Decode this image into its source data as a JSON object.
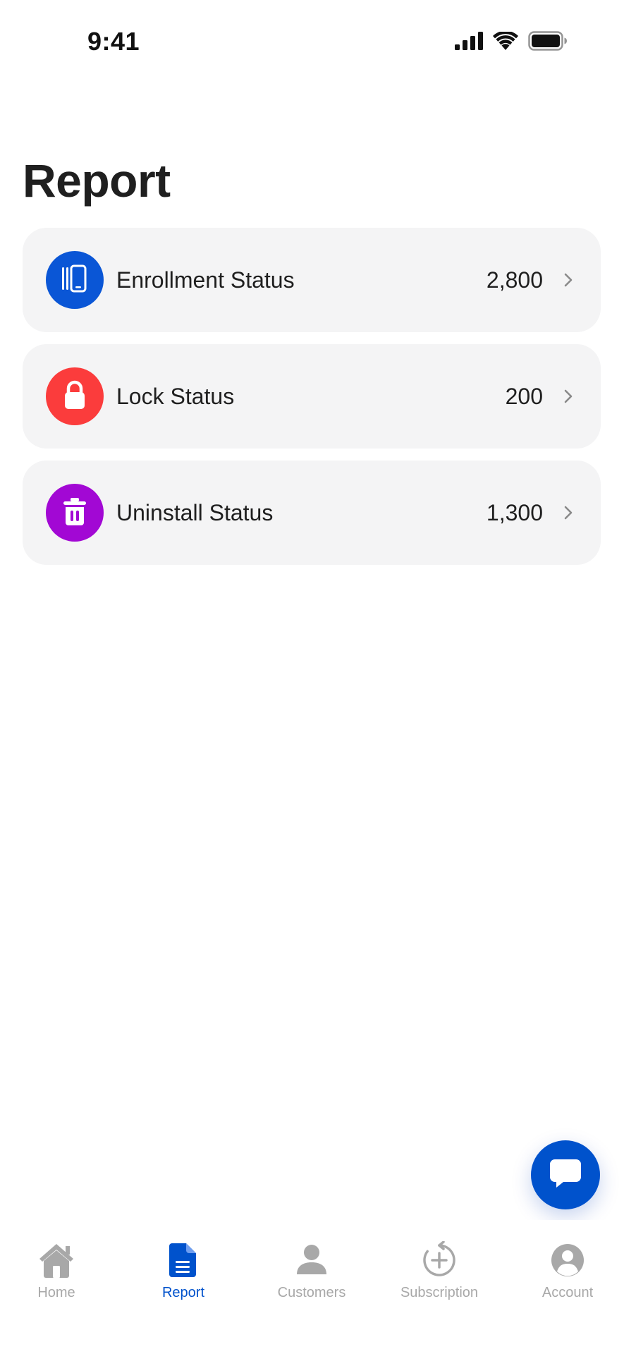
{
  "status_bar": {
    "time": "9:41",
    "icons": [
      "cellular-signal-icon",
      "wifi-icon",
      "battery-icon"
    ]
  },
  "page": {
    "title": "Report"
  },
  "reports": [
    {
      "label": "Enrollment Status",
      "value": "2,800",
      "icon": "phone-stack-icon",
      "color": "#0a56d6"
    },
    {
      "label": "Lock Status",
      "value": "200",
      "icon": "lock-icon",
      "color": "#fb3c3c"
    },
    {
      "label": "Uninstall Status",
      "value": "1,300",
      "icon": "trash-icon",
      "color": "#a208d4"
    }
  ],
  "chat_button": {
    "icon": "chat-bubble-icon",
    "color": "#0052cc"
  },
  "bottom_nav": {
    "items": [
      {
        "label": "Home",
        "icon": "home-icon",
        "active": false
      },
      {
        "label": "Report",
        "icon": "document-icon",
        "active": true
      },
      {
        "label": "Customers",
        "icon": "person-icon",
        "active": false
      },
      {
        "label": "Subscription",
        "icon": "subscription-refresh-icon",
        "active": false
      },
      {
        "label": "Account",
        "icon": "account-circle-icon",
        "active": false
      }
    ],
    "active_color": "#0052cc",
    "inactive_color": "#a8a8a8"
  }
}
